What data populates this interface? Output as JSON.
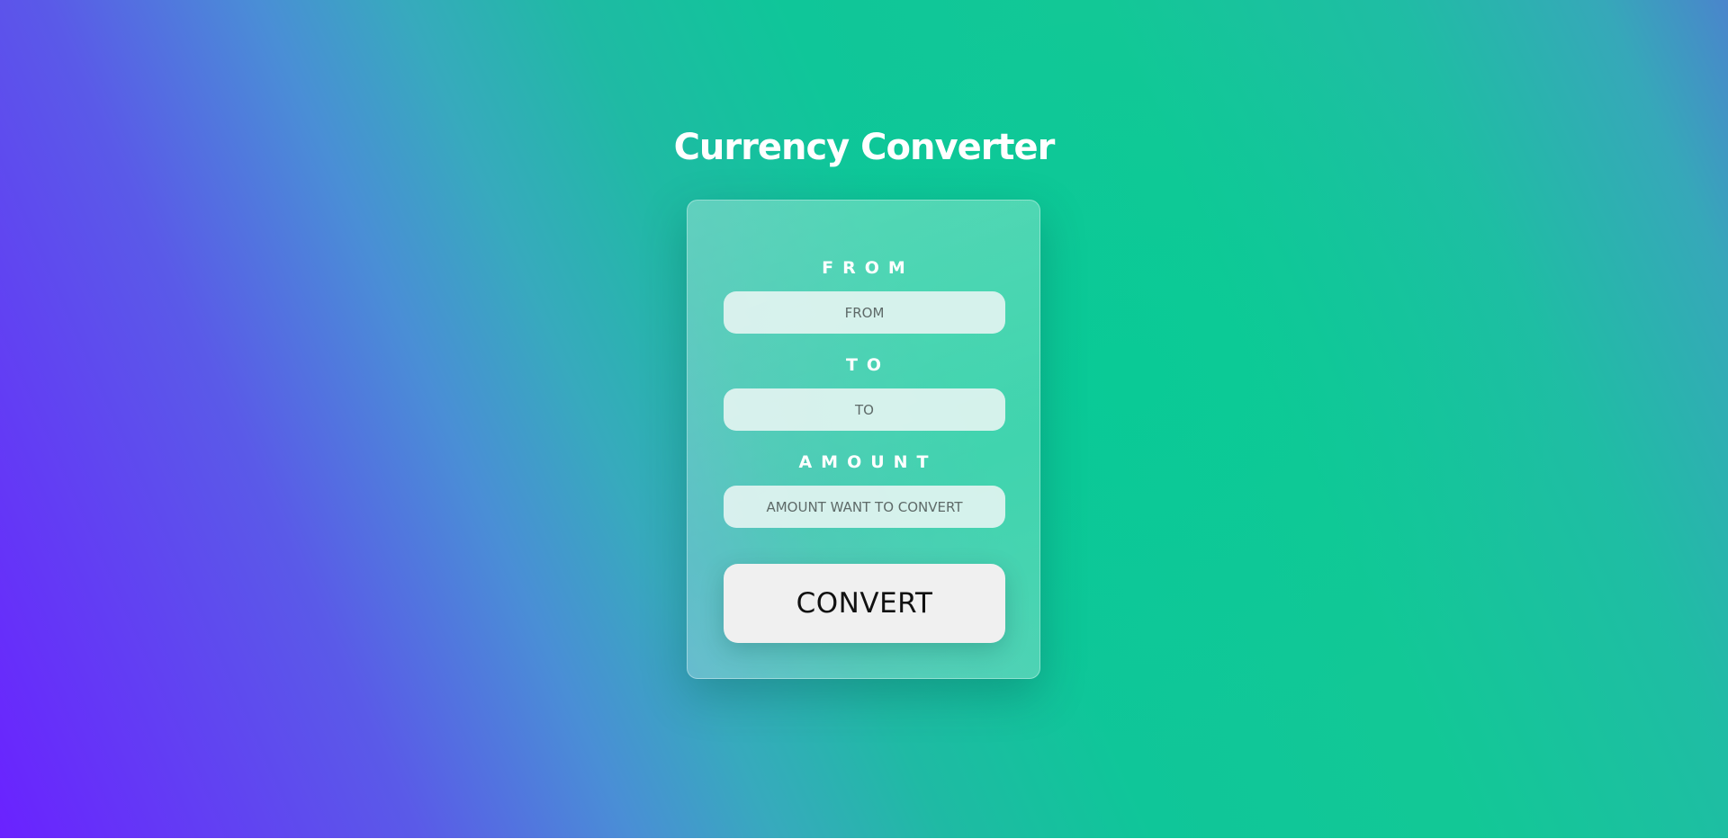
{
  "header": {
    "title": "Currency Converter"
  },
  "form": {
    "from_label": "FROM",
    "from_placeholder": "FROM",
    "to_label": "TO",
    "to_placeholder": "TO",
    "amount_label": "AMOUNT",
    "amount_placeholder": "AMOUNT WANT TO CONVERT",
    "convert_label": "CONVERT"
  },
  "colors": {
    "gradient_start": "#6a22ff",
    "gradient_mid": "#0fc699",
    "gradient_end": "#4a85cc",
    "title_text": "#ffffff",
    "button_bg": "#f0f0f0",
    "button_text": "#111111"
  }
}
